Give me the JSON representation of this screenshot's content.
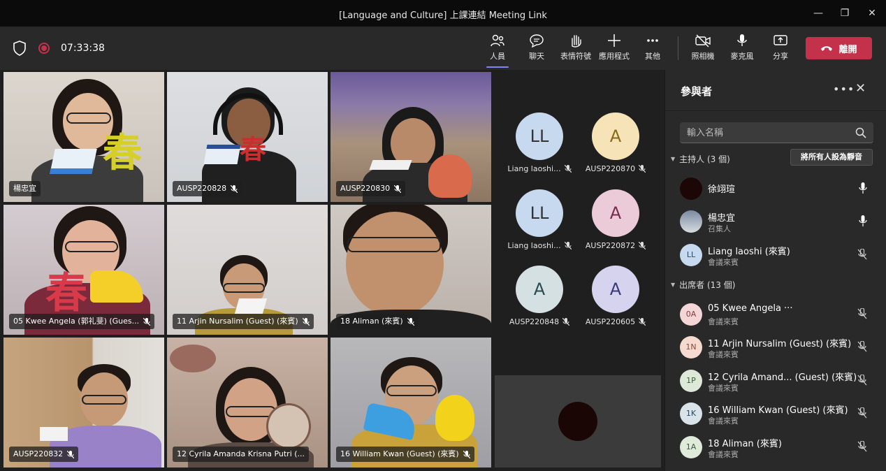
{
  "window": {
    "title": "[Language and Culture] 上課連結 Meeting Link",
    "minimize": "—",
    "maximize": "❐",
    "close": "✕"
  },
  "toolbar": {
    "timer": "07:33:38",
    "people_label": "人員",
    "chat_label": "聊天",
    "reactions_label": "表情符號",
    "apps_label": "應用程式",
    "more_label": "其他",
    "camera_label": "照相機",
    "mic_label": "麥克風",
    "share_label": "分享",
    "leave_label": "離開"
  },
  "tiles": [
    {
      "name": "楊忠宜"
    },
    {
      "name": "AUSP220828"
    },
    {
      "name": "AUSP220830"
    },
    {
      "name": "05 Kwee Angela (郭礼斐) (Gues..."
    },
    {
      "name": "11 Arjin Nursalim (Guest) (來賓)"
    },
    {
      "name": "18 Aliman (來賓)"
    },
    {
      "name": "AUSP220832"
    },
    {
      "name": "12 Cyrila Amanda Krisna Putri (..."
    },
    {
      "name": "16 William Kwan (Guest) (來賓)"
    }
  ],
  "avatars": [
    {
      "initials": "LL",
      "label": "Liang laoshi...",
      "color": "#c7d9ee"
    },
    {
      "initials": "A",
      "label": "AUSP220870",
      "color": "#f6e3b7"
    },
    {
      "initials": "LL",
      "label": "Liang laoshi...",
      "color": "#c7d9ee"
    },
    {
      "initials": "A",
      "label": "AUSP220872",
      "color": "#eccbd8"
    },
    {
      "initials": "A",
      "label": "AUSP220848",
      "color": "#d5e0e3"
    },
    {
      "initials": "A",
      "label": "AUSP220605",
      "color": "#d6d3ee"
    }
  ],
  "panel": {
    "title": "參與者",
    "search_placeholder": "輸入名稱",
    "hosts_header": "主持人 (3 個)",
    "mute_all": "將所有人設為靜音",
    "attendees_header": "出席者 (13 個)",
    "hosts": [
      {
        "name": "徐翊瑄",
        "role": "",
        "initials": ""
      },
      {
        "name": "楊忠宜",
        "role": "召集人",
        "initials": ""
      },
      {
        "name": "Liang laoshi (來賓)",
        "role": "會議來賓",
        "initials": "LL"
      }
    ],
    "attendees": [
      {
        "name": "05 Kwee Angela ···",
        "role": "會議來賓",
        "initials": "0A",
        "color": "#f4d6d6"
      },
      {
        "name": "11 Arjin Nursalim (Guest) (來賓)",
        "role": "會議來賓",
        "initials": "1N",
        "color": "#f6d9cf"
      },
      {
        "name": "12 Cyrila Amand...  (Guest) (來賓)",
        "role": "會議來賓",
        "initials": "1P",
        "color": "#dde8d8"
      },
      {
        "name": "16 William Kwan (Guest) (來賓)",
        "role": "會議來賓",
        "initials": "1K",
        "color": "#d9e4ea"
      },
      {
        "name": "18 Aliman (來賓)",
        "role": "會議來賓",
        "initials": "1A",
        "color": "#dfeadb"
      }
    ]
  }
}
